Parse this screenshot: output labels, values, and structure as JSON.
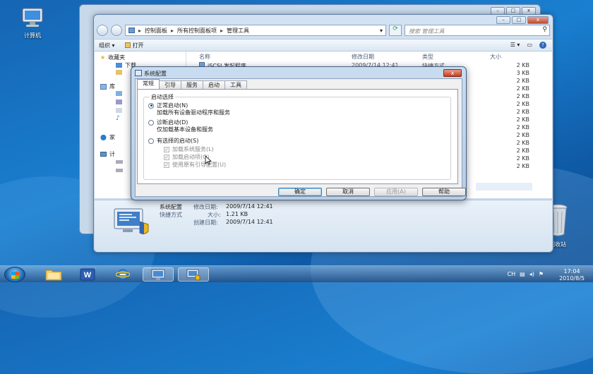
{
  "desktop": {
    "computer_label": "计算机",
    "recycle_label": "回收站"
  },
  "explorer": {
    "address": {
      "root_icon": "control-panel-icon",
      "crumb1": "控制面板",
      "crumb2": "所有控制面板项",
      "crumb3": "管理工具",
      "sep": "▸"
    },
    "search_placeholder": "搜索 管理工具",
    "cmd": {
      "organize": "组织 ▾",
      "open": "打开"
    },
    "nav": {
      "favorites": "收藏夹",
      "downloads": "下载",
      "libraries": "库",
      "homegroup": "家",
      "computer": "计"
    },
    "columns": {
      "name": "名称",
      "modified": "修改日期",
      "type": "类型",
      "size": "大小"
    },
    "first_row": {
      "name": "iSCSI 发起程序",
      "modified": "2009/7/14 12:41",
      "type": "快捷方式",
      "size": "2 KB"
    },
    "sizes": [
      "3 KB",
      "2 KB",
      "2 KB",
      "2 KB",
      "2 KB",
      "2 KB",
      "2 KB",
      "2 KB",
      "2 KB",
      "2 KB",
      "2 KB",
      "2 KB",
      "2 KB"
    ],
    "details": {
      "name": "系统配置",
      "type": "快捷方式",
      "modified_label": "修改日期:",
      "modified_value": "2009/7/14 12:41",
      "size_label": "大小:",
      "size_value": "1.21 KB",
      "created_label": "创建日期:",
      "created_value": "2009/7/14 12:41"
    }
  },
  "dialog": {
    "title": "系统配置",
    "close": "x",
    "tabs": [
      "常规",
      "引导",
      "服务",
      "启动",
      "工具"
    ],
    "group_title": "启动选择",
    "normal": {
      "label": "正常启动(N)",
      "desc": "加载所有设备驱动程序和服务"
    },
    "diagnostic": {
      "label": "诊断启动(D)",
      "desc": "仅加载基本设备和服务"
    },
    "selective": {
      "label": "有选择的启动(S)"
    },
    "checks": [
      "加载系统服务(L)",
      "加载启动项(O)",
      "使用原有引导配置(U)"
    ],
    "buttons": {
      "ok": "确定",
      "cancel": "取消",
      "apply": "应用(A)",
      "help": "帮助"
    }
  },
  "taskbar": {
    "time": "17:04",
    "date": "2010/8/5",
    "tray_lang": "CH"
  }
}
